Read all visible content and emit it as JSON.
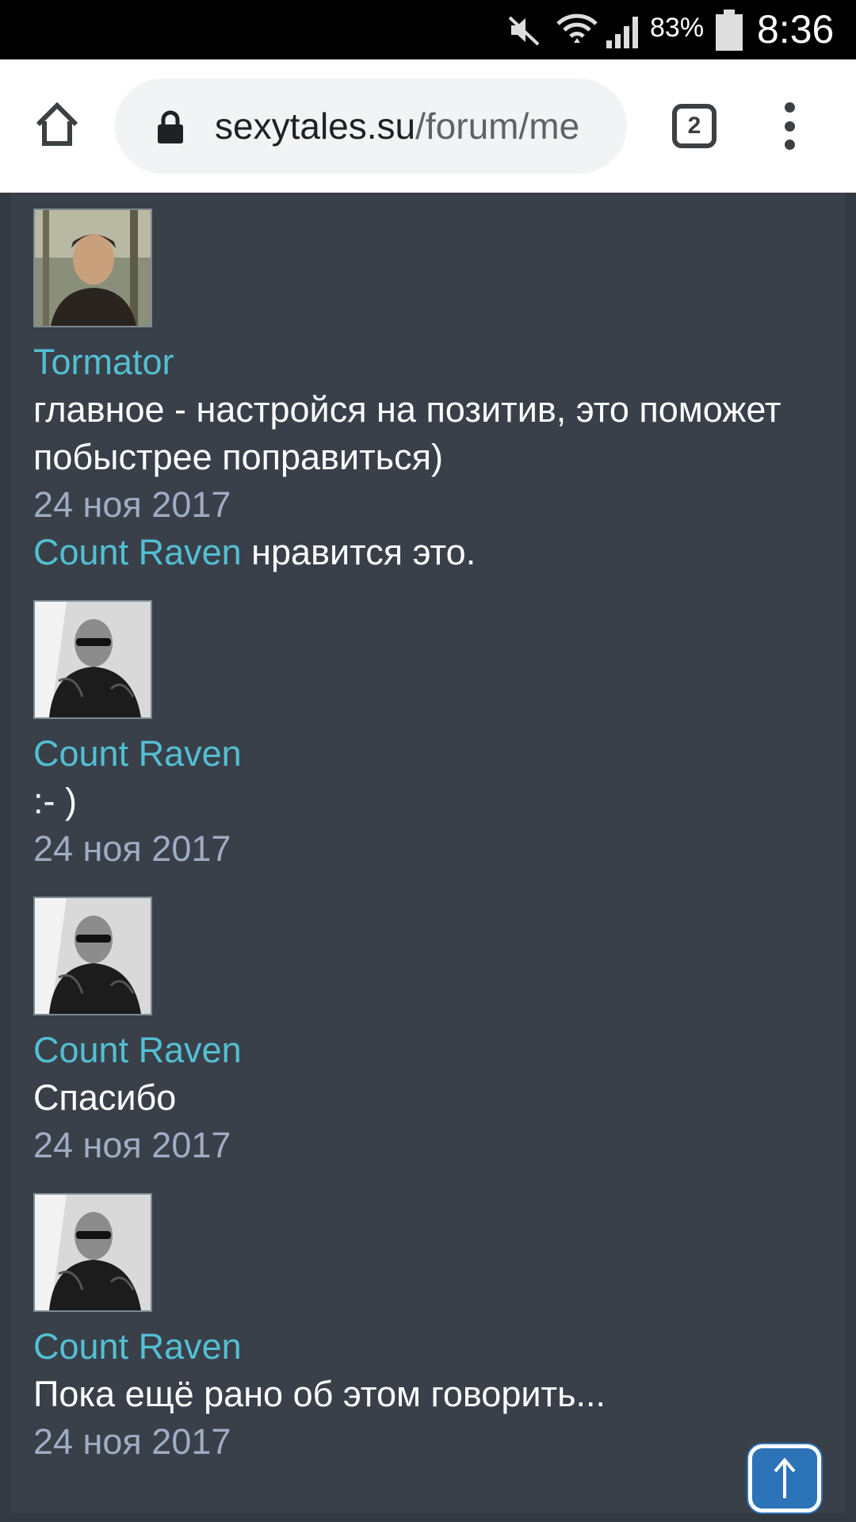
{
  "status_bar": {
    "battery_percent": "83%",
    "time": "8:36",
    "icons": [
      "mute-icon",
      "wifi-icon",
      "signal-icon",
      "battery-icon"
    ]
  },
  "browser": {
    "url_host": "sexytales.su",
    "url_path": "/forum/me",
    "tab_count": "2",
    "icons": [
      "home-icon",
      "lock-icon",
      "tabs-icon",
      "more-menu-icon"
    ]
  },
  "posts": [
    {
      "author": "Tormator",
      "message": "главное - настройся на позитив, это поможет побыстрее поправиться)",
      "date": "24 ноя 2017",
      "likes": {
        "user": "Count Raven",
        "text": " нравится это."
      }
    },
    {
      "author": "Count Raven",
      "message": ":- )",
      "date": "24 ноя 2017"
    },
    {
      "author": "Count Raven",
      "message": "Спасибо",
      "date": "24 ноя 2017"
    },
    {
      "author": "Count Raven",
      "message": "Пока ещё рано об этом говорить...",
      "date": "24 ноя 2017"
    }
  ],
  "scroll_top": {
    "icon": "arrow-up-icon",
    "accent": "#2d73b8"
  },
  "colors": {
    "page_bg": "#39404a",
    "link": "#53bfd2",
    "date": "#a0acc4"
  }
}
